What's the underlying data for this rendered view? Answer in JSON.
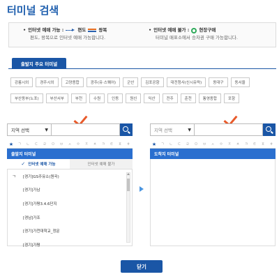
{
  "title": "터미널 검색",
  "info": {
    "left": {
      "prefix": "인터넷 예매 가능 :",
      "oneway_label": "편도",
      "roundtrip_label": "왕복",
      "sub": "편도, 왕복으로 인터넷 예매 가능합니다."
    },
    "right": {
      "prefix": "인터넷 예매 불가 :",
      "onsite_label": "현장구매",
      "sub": "터미널 매표소에서 승차권 구매 가능합니다."
    }
  },
  "tab_label": "출발지 주요 터미널",
  "terminals_row1": [
    "강릉시외",
    "경주시외",
    "고양종합",
    "광주(유·스퀘어)",
    "군산",
    "김포공항",
    "대전청사(신시유락)",
    "동대구",
    "동서울"
  ],
  "terminals_row2": [
    "부산동부(노포)",
    "부산서부",
    "부천",
    "수원",
    "인동",
    "원신",
    "익산",
    "전주",
    "춘천",
    "통영종합",
    "포항"
  ],
  "departure": {
    "region_select": "지역 선택",
    "head": "출발지 터미널",
    "subtab_on": "인터넷 예매 가능",
    "subtab_off": "인터넷 예매 불가",
    "group_initial": "ㄱ",
    "items": [
      "[경기]GS주유소(원곡)",
      "[경기]가남",
      "[경기]가평3.4.6단지",
      "[경남]가조",
      "[경기]가천대학교_정문",
      "[경기]가평"
    ]
  },
  "arrival": {
    "region_select": "지역 선택",
    "head": "도착지 터미널"
  },
  "consonants": [
    "★",
    "ㄱ",
    "ㄴ",
    "ㄷ",
    "ㄹ",
    "ㅁ",
    "ㅂ",
    "ㅅ",
    "ㅇ",
    "ㅈ",
    "ㅊ",
    "ㅋ",
    "ㅌ",
    "ㅍ",
    "ㅎ"
  ],
  "close_label": "닫기",
  "colors": {
    "primary": "#1a56a6",
    "header": "#2a6fcf",
    "accent": "#e85a2a",
    "onsite": "#2eaa5a"
  }
}
